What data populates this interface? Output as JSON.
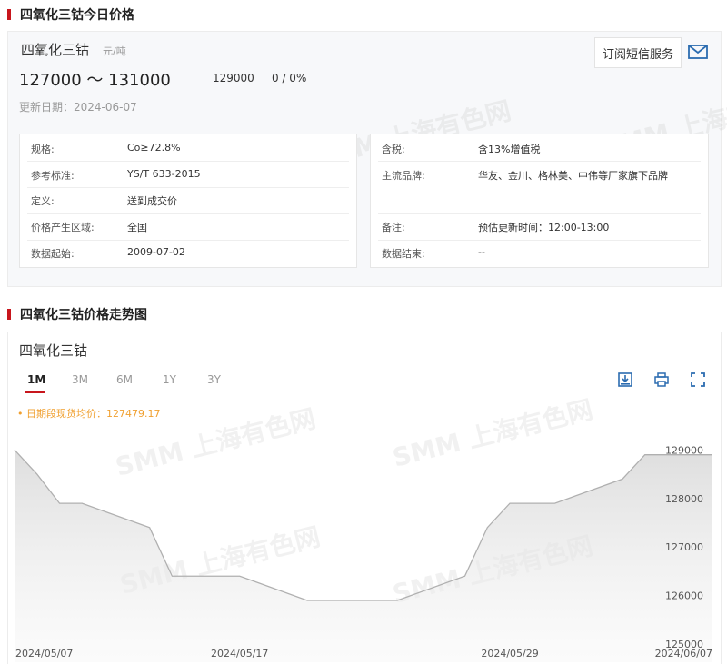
{
  "section1": {
    "title": "四氧化三钴今日价格"
  },
  "price_card": {
    "product_name": "四氧化三钴",
    "unit": "元/吨",
    "price_range": "127000 ～ 131000",
    "average": "129000",
    "change": "0 / 0%",
    "update_date": "更新日期：2024-06-07",
    "subscribe_label": "订阅短信服务",
    "watermark": "SMM 上海有色网"
  },
  "info_left": [
    {
      "label": "规格:",
      "value": "Co≥72.8%"
    },
    {
      "label": "参考标准:",
      "value": "YS/T 633-2015"
    },
    {
      "label": "定义:",
      "value": "送到成交价"
    },
    {
      "label": "价格产生区域:",
      "value": "全国"
    },
    {
      "label": "数据起始:",
      "value": "2009-07-02"
    }
  ],
  "info_right": [
    {
      "label": "含税:",
      "value": "含13%增值税"
    },
    {
      "label": "主流品牌:",
      "value": "华友、金川、格林美、中伟等厂家旗下品牌"
    },
    {
      "label": "备注:",
      "value": "预估更新时间：12:00-13:00"
    },
    {
      "label": "数据结束:",
      "value": "--"
    }
  ],
  "section2": {
    "title": "四氧化三钴价格走势图"
  },
  "chart_panel": {
    "title": "四氧化三钴",
    "tabs": [
      "1M",
      "3M",
      "6M",
      "1Y",
      "3Y"
    ],
    "active_tab": "1M",
    "avg_note": "日期段现货均价：127479.17",
    "tools": [
      "download-image-icon",
      "print-icon",
      "fullscreen-icon"
    ]
  },
  "colors": {
    "accent": "#c8161d",
    "line": "#b0b0b0",
    "avg_note": "#f0a030"
  },
  "chart_data": {
    "type": "area",
    "x": [
      "2024-05-07",
      "2024-05-08",
      "2024-05-09",
      "2024-05-10",
      "2024-05-13",
      "2024-05-14",
      "2024-05-15",
      "2024-05-16",
      "2024-05-17",
      "2024-05-20",
      "2024-05-21",
      "2024-05-22",
      "2024-05-23",
      "2024-05-24",
      "2024-05-27",
      "2024-05-28",
      "2024-05-29",
      "2024-05-30",
      "2024-05-31",
      "2024-06-03",
      "2024-06-04",
      "2024-06-05",
      "2024-06-06",
      "2024-06-07"
    ],
    "series": [
      {
        "values": [
          129000,
          128500,
          127900,
          127900,
          127400,
          126400,
          126400,
          126400,
          126400,
          125900,
          125900,
          125900,
          125900,
          125900,
          126400,
          127400,
          127900,
          127900,
          127900,
          128400,
          128900,
          128900,
          128900,
          128900
        ]
      }
    ],
    "x_tick_labels": [
      "2024/05/07",
      "2024/05/17",
      "2024/05/29",
      "2024/06/07"
    ],
    "y_ticks": [
      125000,
      126000,
      127000,
      128000,
      129000
    ],
    "ylim": [
      125000,
      129400
    ],
    "y_axis_position": "right",
    "grid": false
  }
}
